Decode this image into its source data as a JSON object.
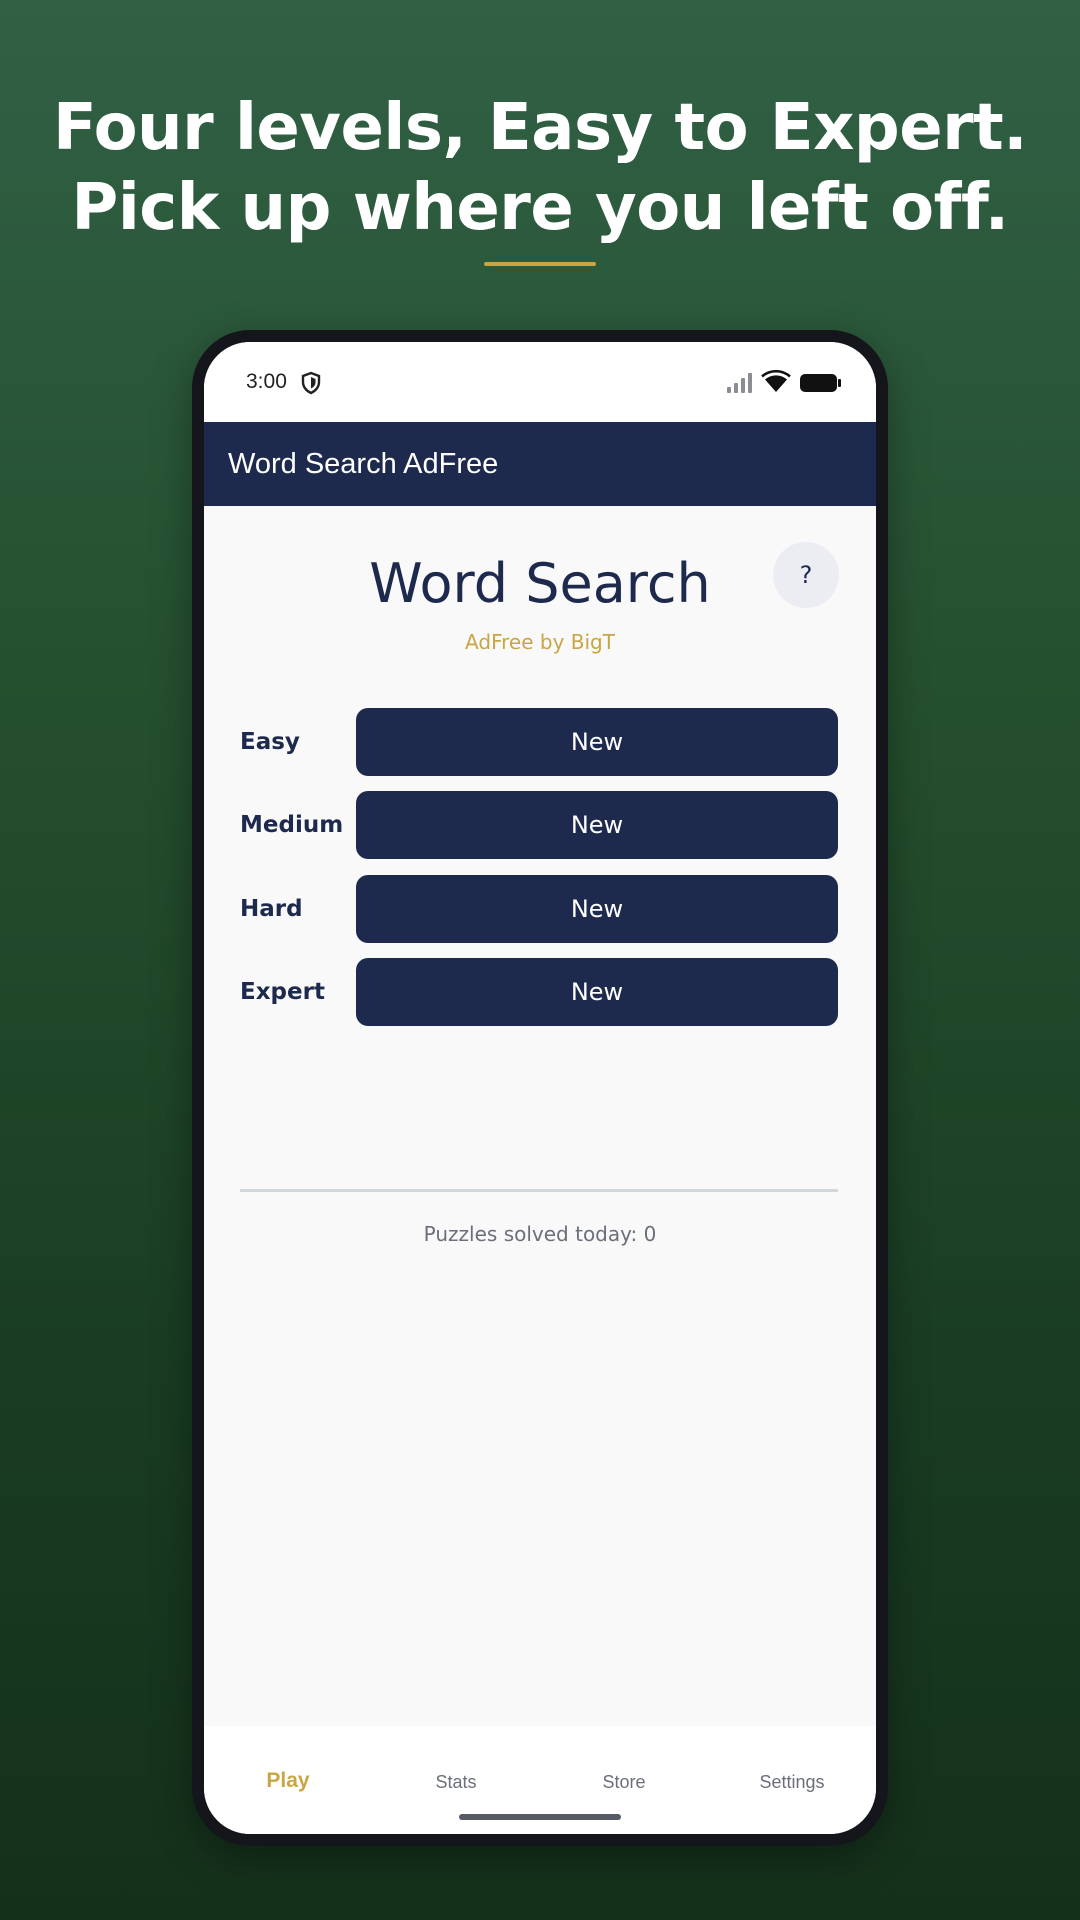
{
  "headline": {
    "line1": "Four levels, Easy to Expert.",
    "line2": "Pick up where you left off."
  },
  "status_bar": {
    "time": "3:00",
    "icons": [
      "shield-icon",
      "signal-icon",
      "wifi-icon",
      "battery-icon"
    ]
  },
  "app_bar": {
    "title": "Word Search AdFree"
  },
  "main": {
    "title": "Word Search",
    "subtitle": "AdFree by BigT",
    "help_label": "?",
    "levels": [
      {
        "label": "Easy",
        "button": "New"
      },
      {
        "label": "Medium",
        "button": "New"
      },
      {
        "label": "Hard",
        "button": "New"
      },
      {
        "label": "Expert",
        "button": "New"
      }
    ],
    "solved_text": "Puzzles solved today: 0"
  },
  "bottom_nav": {
    "items": [
      {
        "label": "Play",
        "active": true
      },
      {
        "label": "Stats",
        "active": false
      },
      {
        "label": "Store",
        "active": false
      },
      {
        "label": "Settings",
        "active": false
      }
    ]
  },
  "colors": {
    "background_top": "#316045",
    "background_bottom": "#14301b",
    "navy": "#1d2a4d",
    "gold_accent": "#c9a544",
    "screen_bg": "#f9f9fa"
  }
}
